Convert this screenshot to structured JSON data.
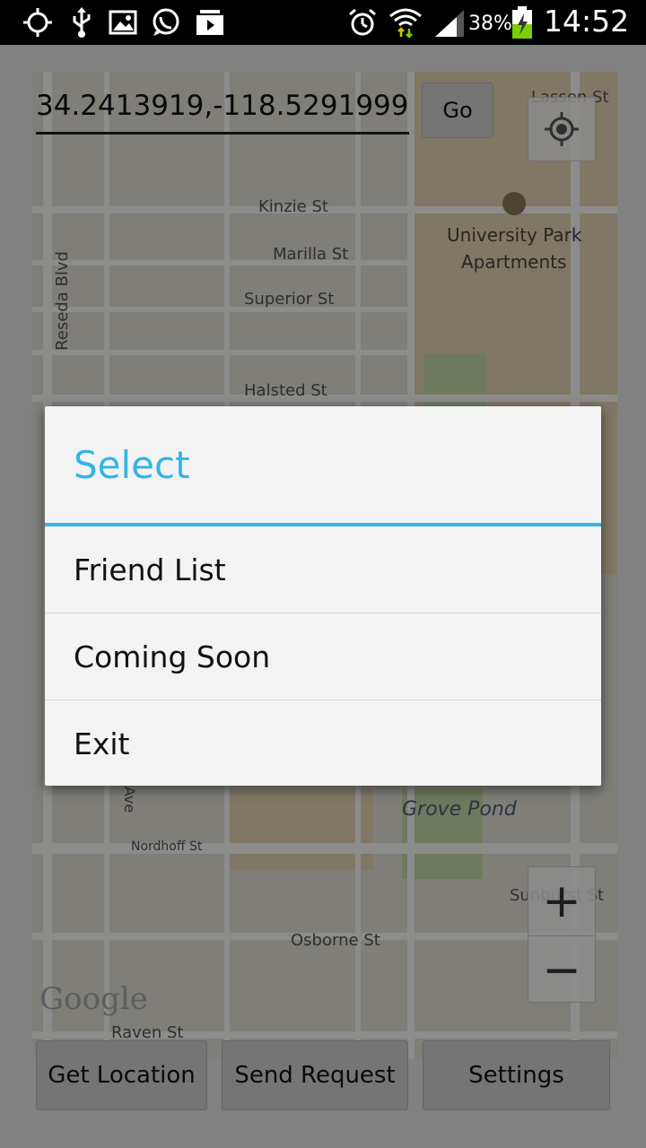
{
  "status_bar": {
    "battery_percent": "38%",
    "time": "14:52",
    "icons": [
      "gps-icon",
      "usb-icon",
      "image-icon",
      "whatsapp-icon",
      "media-upload-icon",
      "alarm-icon",
      "wifi-icon",
      "signal-icon",
      "battery-charging-icon"
    ]
  },
  "map": {
    "coord_input_value": "34.2413919,-118.5291999",
    "go_label": "Go",
    "street_labels": {
      "lassen": "Lassen St",
      "kinzie": "Kinzie St",
      "marilla": "Marilla St",
      "superior": "Superior St",
      "halsted": "Halsted St",
      "reseda": "Reseda Blvd",
      "university_park_line1": "University Park",
      "university_park_line2": "Apartments",
      "ave": "Ave",
      "grove_pond": "Grove Pond",
      "nordhoff": "Nordhoff St",
      "sunburst": "Sunburst St",
      "osborne": "Osborne St",
      "raven": "Raven St"
    },
    "zoom_in_label": "+",
    "zoom_out_label": "−",
    "attribution": "Google"
  },
  "bottom_buttons": {
    "get_location": "Get Location",
    "send_request": "Send Request",
    "settings": "Settings"
  },
  "dialog": {
    "title": "Select",
    "items": [
      {
        "label": "Friend List"
      },
      {
        "label": "Coming Soon"
      },
      {
        "label": "Exit"
      }
    ]
  },
  "colors": {
    "accent": "#33b5e5",
    "status_bar_bg": "#000000",
    "dialog_bg": "#f3f3f3"
  }
}
